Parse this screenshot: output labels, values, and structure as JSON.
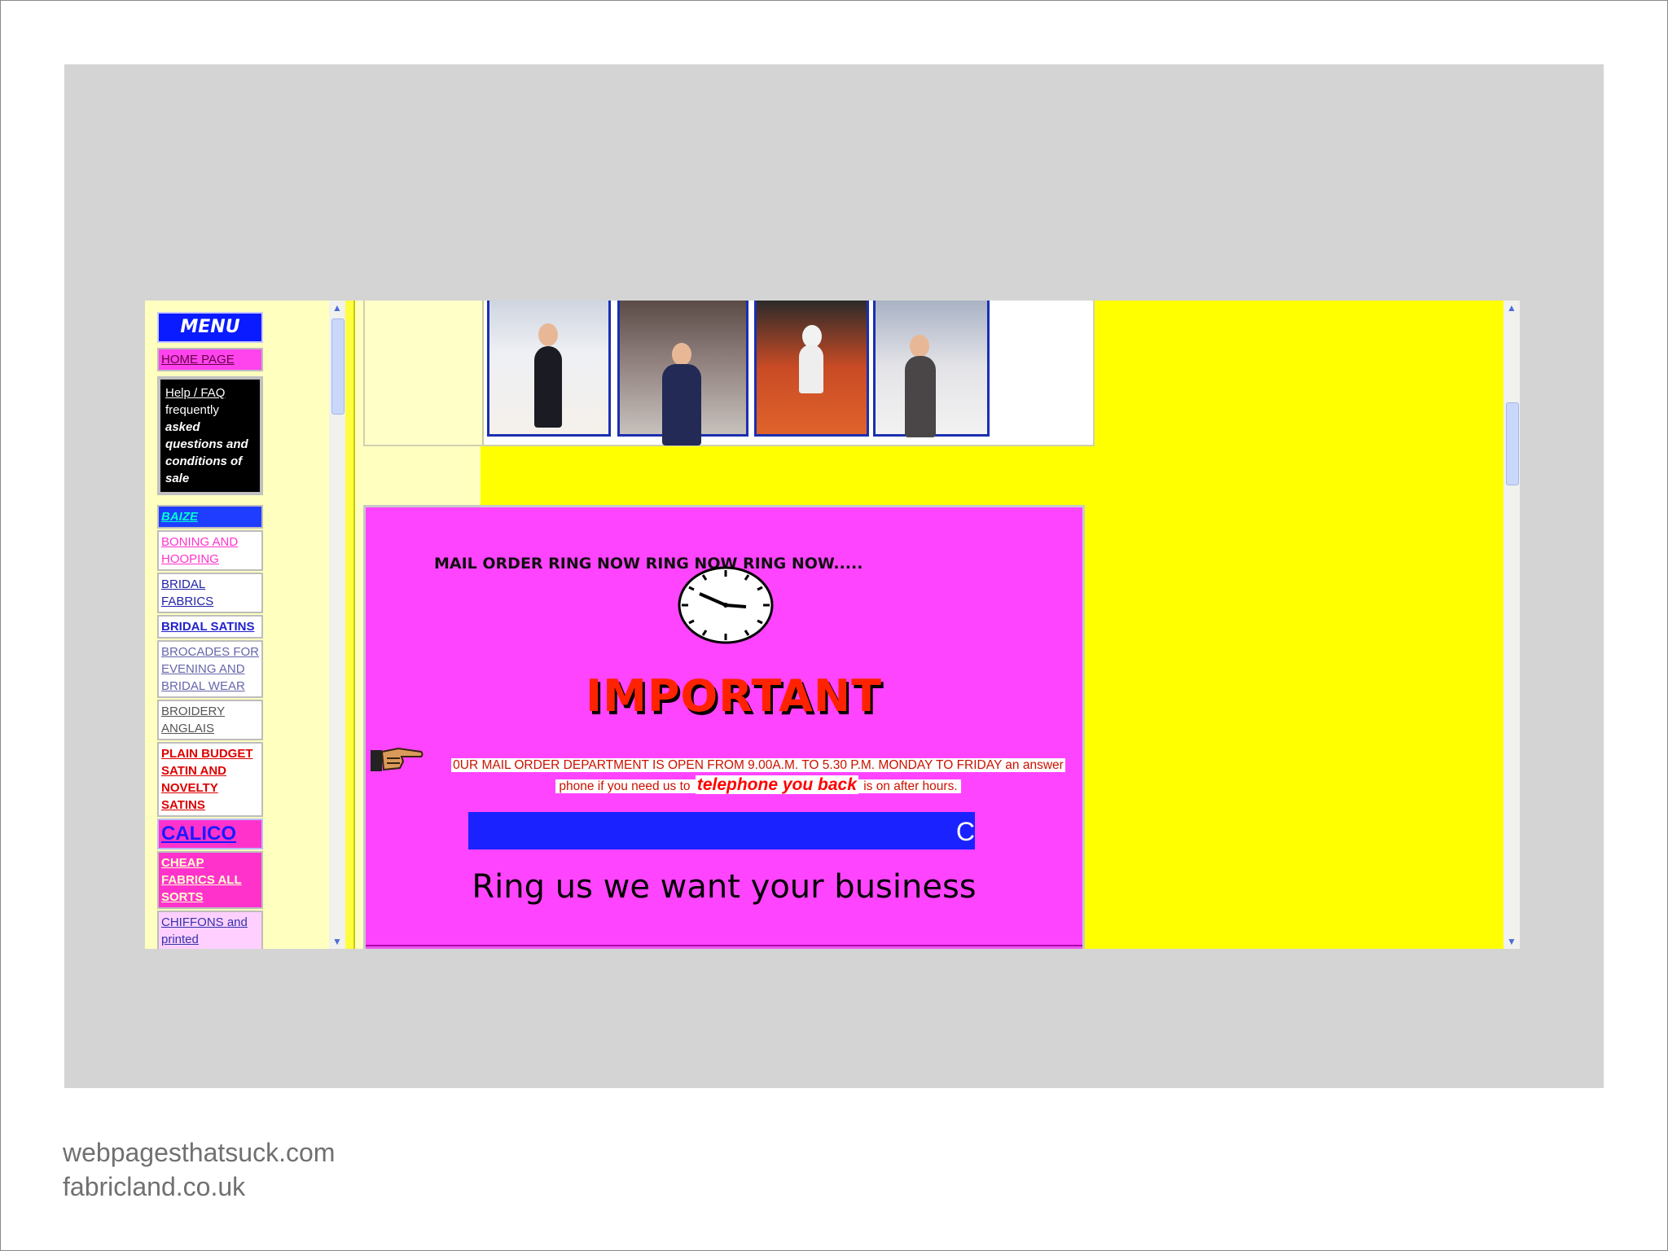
{
  "menu": {
    "title": "MENU",
    "home": "HOME PAGE",
    "help": {
      "link": "Help / FAQ",
      "text_1": "frequently",
      "text_2": "asked",
      "text_3": "questions and",
      "text_4": "conditions of",
      "text_5": "sale"
    },
    "items": [
      "BAIZE",
      "BONING AND HOOPING",
      "BRIDAL FABRICS",
      "BRIDAL SATINS",
      "BROCADES FOR EVENING AND BRIDAL WEAR",
      "BROIDERY ANGLAIS",
      "PLAIN BUDGET SATIN AND NOVELTY SATINS",
      "CALICO",
      "CHEAP FABRICS ALL SORTS"
    ],
    "chiffons": {
      "link": "CHIFFONS",
      "rest": "and printed GEORGETTES"
    }
  },
  "promo": {
    "ring_line": "MAIL ORDER RING NOW RING NOW RING NOW.....",
    "important": "IMPORTANT",
    "notice_1": "0UR MAIL ORDER DEPARTMENT IS OPEN FROM 9.00A.M. TO 5.30 P.M. MONDAY TO FRIDAY an answer",
    "notice_2a": "phone if you need us to",
    "notice_2b": "telephone you back",
    "notice_2c": "is on after hours.",
    "marquee_char": "C",
    "tagline": "Ring us we want your business"
  },
  "caption": {
    "line1": "webpagesthatsuck.com",
    "line2": "fabricland.co.uk"
  },
  "colors": {
    "page_background": "#ffff00",
    "menu_background": "#ffffc0",
    "promo_background": "#ff44ff",
    "marquee": "#1a22ff",
    "important": "#ff2200"
  },
  "icons": [
    "clock-icon",
    "pointing-hand-icon",
    "scroll-up-arrow-icon",
    "scroll-down-arrow-icon"
  ]
}
